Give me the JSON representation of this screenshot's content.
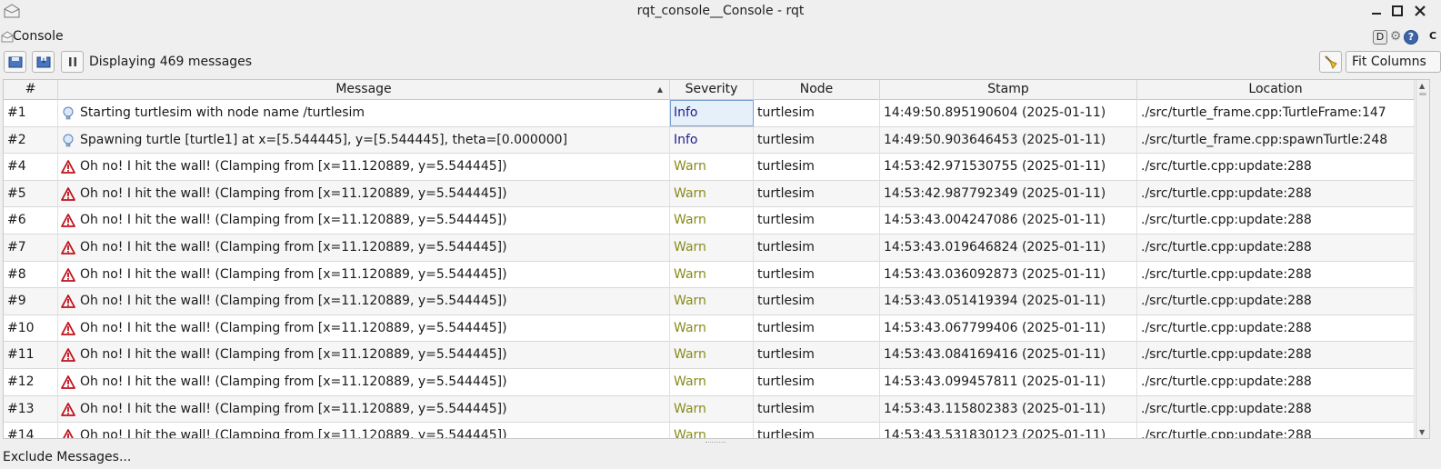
{
  "window": {
    "title": "rqt_console__Console - rqt",
    "controls": [
      "minimize-icon",
      "maximize-icon",
      "close-icon"
    ]
  },
  "plugin": {
    "title": "Console",
    "btn_d": "D",
    "btn_gear": "⚙",
    "btn_help": "?",
    "btn_close": "C"
  },
  "toolbar": {
    "status": "Displaying 469 messages",
    "fit_columns": "Fit Columns"
  },
  "table": {
    "columns": [
      "#",
      "Message",
      "Severity",
      "Node",
      "Stamp",
      "Location"
    ],
    "rows": [
      {
        "num": "#1",
        "message": "Starting turtlesim with node name /turtlesim",
        "severity": "Info",
        "node": "turtlesim",
        "stamp": "14:49:50.895190604 (2025-01-11)",
        "location": "./src/turtle_frame.cpp:TurtleFrame:147"
      },
      {
        "num": "#2",
        "message": "Spawning turtle [turtle1] at x=[5.544445], y=[5.544445], theta=[0.000000]",
        "severity": "Info",
        "node": "turtlesim",
        "stamp": "14:49:50.903646453 (2025-01-11)",
        "location": "./src/turtle_frame.cpp:spawnTurtle:248"
      },
      {
        "num": "#4",
        "message": "Oh no! I hit the wall! (Clamping from [x=11.120889, y=5.544445])",
        "severity": "Warn",
        "node": "turtlesim",
        "stamp": "14:53:42.971530755 (2025-01-11)",
        "location": "./src/turtle.cpp:update:288"
      },
      {
        "num": "#5",
        "message": "Oh no! I hit the wall! (Clamping from [x=11.120889, y=5.544445])",
        "severity": "Warn",
        "node": "turtlesim",
        "stamp": "14:53:42.987792349 (2025-01-11)",
        "location": "./src/turtle.cpp:update:288"
      },
      {
        "num": "#6",
        "message": "Oh no! I hit the wall! (Clamping from [x=11.120889, y=5.544445])",
        "severity": "Warn",
        "node": "turtlesim",
        "stamp": "14:53:43.004247086 (2025-01-11)",
        "location": "./src/turtle.cpp:update:288"
      },
      {
        "num": "#7",
        "message": "Oh no! I hit the wall! (Clamping from [x=11.120889, y=5.544445])",
        "severity": "Warn",
        "node": "turtlesim",
        "stamp": "14:53:43.019646824 (2025-01-11)",
        "location": "./src/turtle.cpp:update:288"
      },
      {
        "num": "#8",
        "message": "Oh no! I hit the wall! (Clamping from [x=11.120889, y=5.544445])",
        "severity": "Warn",
        "node": "turtlesim",
        "stamp": "14:53:43.036092873 (2025-01-11)",
        "location": "./src/turtle.cpp:update:288"
      },
      {
        "num": "#9",
        "message": "Oh no! I hit the wall! (Clamping from [x=11.120889, y=5.544445])",
        "severity": "Warn",
        "node": "turtlesim",
        "stamp": "14:53:43.051419394 (2025-01-11)",
        "location": "./src/turtle.cpp:update:288"
      },
      {
        "num": "#10",
        "message": "Oh no! I hit the wall! (Clamping from [x=11.120889, y=5.544445])",
        "severity": "Warn",
        "node": "turtlesim",
        "stamp": "14:53:43.067799406 (2025-01-11)",
        "location": "./src/turtle.cpp:update:288"
      },
      {
        "num": "#11",
        "message": "Oh no! I hit the wall! (Clamping from [x=11.120889, y=5.544445])",
        "severity": "Warn",
        "node": "turtlesim",
        "stamp": "14:53:43.084169416 (2025-01-11)",
        "location": "./src/turtle.cpp:update:288"
      },
      {
        "num": "#12",
        "message": "Oh no! I hit the wall! (Clamping from [x=11.120889, y=5.544445])",
        "severity": "Warn",
        "node": "turtlesim",
        "stamp": "14:53:43.099457811 (2025-01-11)",
        "location": "./src/turtle.cpp:update:288"
      },
      {
        "num": "#13",
        "message": "Oh no! I hit the wall! (Clamping from [x=11.120889, y=5.544445])",
        "severity": "Warn",
        "node": "turtlesim",
        "stamp": "14:53:43.115802383 (2025-01-11)",
        "location": "./src/turtle.cpp:update:288"
      },
      {
        "num": "#14",
        "message": "Oh no! I hit the wall! (Clamping from [x=11.120889, y=5.544445])",
        "severity": "Warn",
        "node": "turtlesim",
        "stamp": "14:53:43.531830123 (2025-01-11)",
        "location": "./src/turtle.cpp:update:288"
      }
    ]
  },
  "icons": {
    "info": "lightbulb-icon",
    "warn": "warning-triangle-icon"
  },
  "colors": {
    "info_text": "#1d1d8f",
    "warn_text": "#8a8a1a",
    "warn_icon": "#c0101a"
  },
  "footer": {
    "exclude_label": "Exclude Messages..."
  }
}
